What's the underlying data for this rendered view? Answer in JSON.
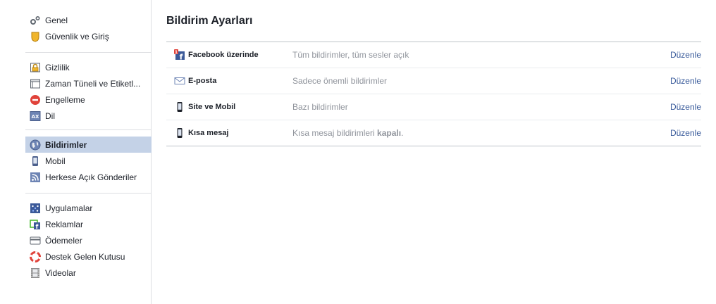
{
  "sidebar": {
    "groups": [
      [
        {
          "label": "Genel",
          "icon": "gears-icon"
        },
        {
          "label": "Güvenlik ve Giriş",
          "icon": "security-badge-icon"
        }
      ],
      [
        {
          "label": "Gizlilik",
          "icon": "lock-icon"
        },
        {
          "label": "Zaman Tüneli ve Etiketl...",
          "icon": "timeline-icon"
        },
        {
          "label": "Engelleme",
          "icon": "block-icon"
        },
        {
          "label": "Dil",
          "icon": "language-icon"
        }
      ],
      [
        {
          "label": "Bildirimler",
          "icon": "globe-icon",
          "active": true
        },
        {
          "label": "Mobil",
          "icon": "mobile-icon"
        },
        {
          "label": "Herkese Açık Gönderiler",
          "icon": "rss-icon"
        }
      ],
      [
        {
          "label": "Uygulamalar",
          "icon": "apps-icon"
        },
        {
          "label": "Reklamlar",
          "icon": "ads-icon"
        },
        {
          "label": "Ödemeler",
          "icon": "credit-card-icon"
        },
        {
          "label": "Destek Gelen Kutusu",
          "icon": "lifebuoy-icon"
        },
        {
          "label": "Videolar",
          "icon": "film-icon"
        }
      ]
    ]
  },
  "main": {
    "title": "Bildirim Ayarları",
    "rows": [
      {
        "title": "Facebook üzerinde",
        "desc": "Tüm bildirimler, tüm sesler açık",
        "desc_bold": "",
        "desc_tail": "",
        "edit": "Düzenle",
        "icon": "facebook-notification-icon"
      },
      {
        "title": "E-posta",
        "desc": "Sadece önemli bildirimler",
        "desc_bold": "",
        "desc_tail": "",
        "edit": "Düzenle",
        "icon": "envelope-icon"
      },
      {
        "title": "Site ve Mobil",
        "desc": "Bazı bildirimler",
        "desc_bold": "",
        "desc_tail": "",
        "edit": "Düzenle",
        "icon": "phone-icon"
      },
      {
        "title": "Kısa mesaj",
        "desc": "Kısa mesaj bildirimleri ",
        "desc_bold": "kapalı",
        "desc_tail": ".",
        "edit": "Düzenle",
        "icon": "sms-phone-icon"
      }
    ]
  }
}
